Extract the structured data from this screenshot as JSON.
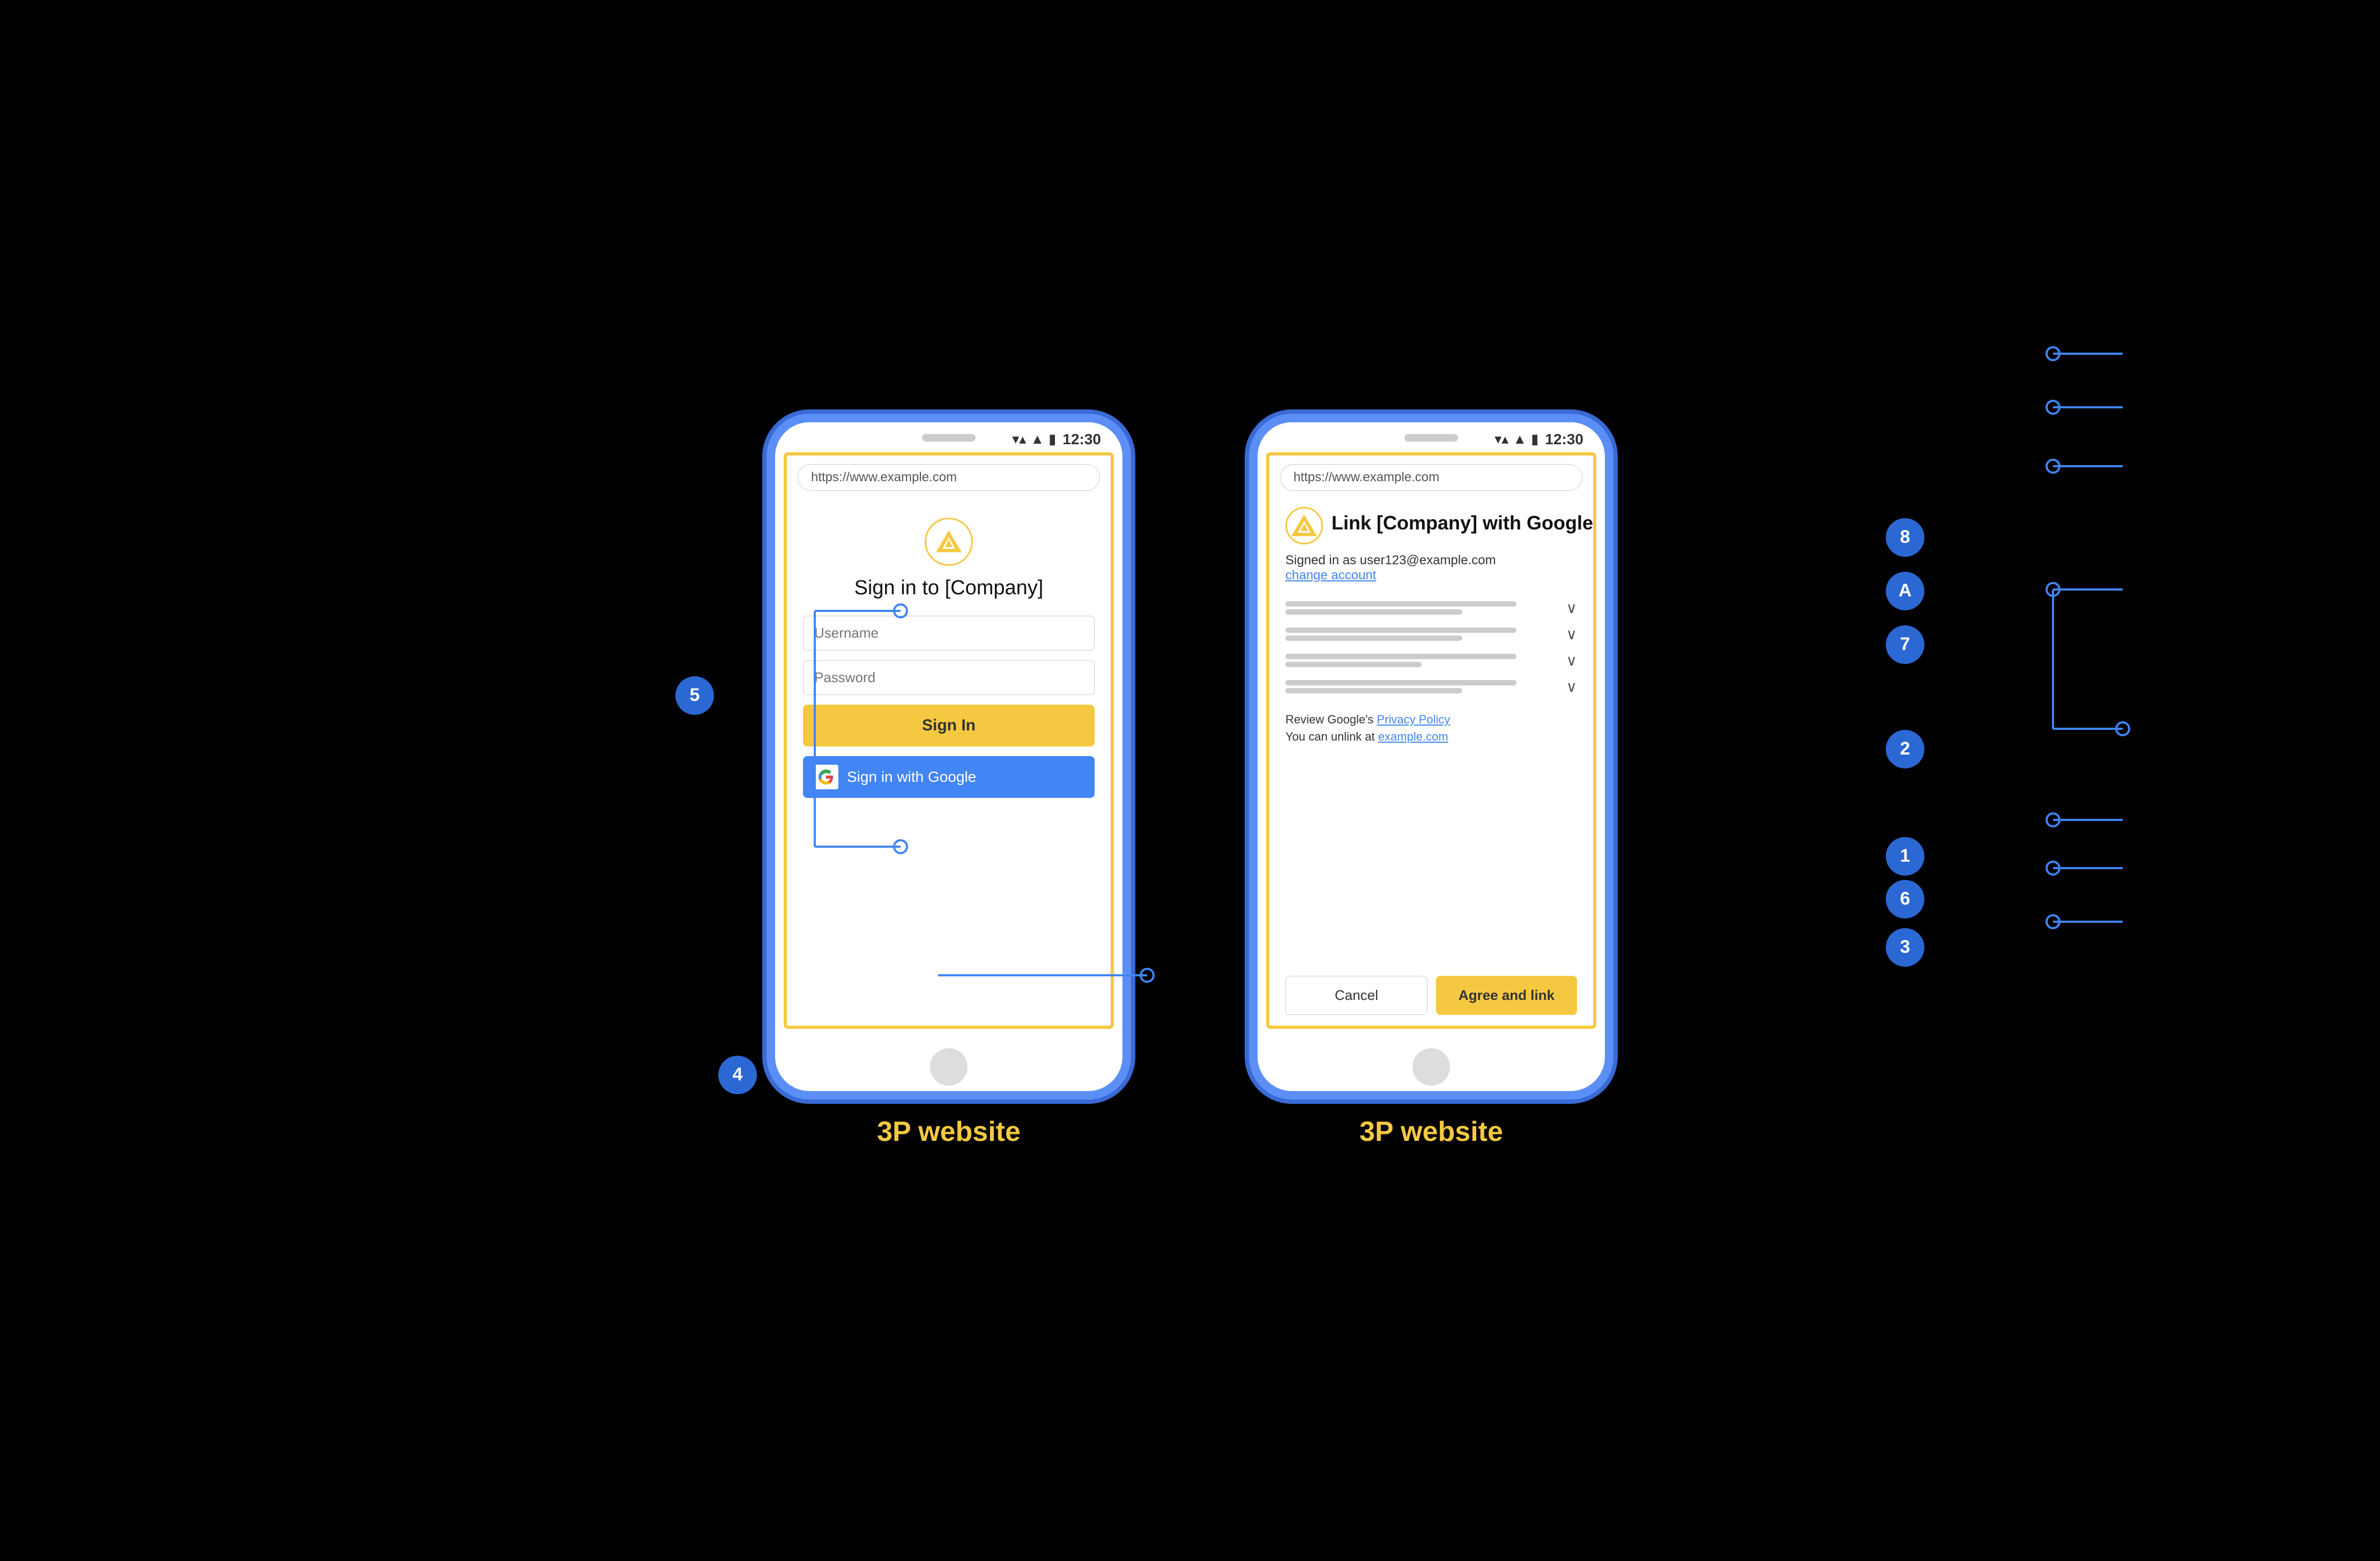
{
  "page": {
    "background": "#000000"
  },
  "phone1": {
    "label": "3P website",
    "status": {
      "time": "12:30",
      "wifi_icon": "▼",
      "signal_icon": "▲",
      "battery_icon": "▮"
    },
    "url": "https://www.example.com",
    "logo_shape": "triangle",
    "title": "Sign in to [Company]",
    "username_placeholder": "Username",
    "password_placeholder": "Password",
    "sign_in_label": "Sign In",
    "google_sign_in_label": "Sign in with Google"
  },
  "phone2": {
    "label": "3P website",
    "status": {
      "time": "12:30"
    },
    "url": "https://www.example.com",
    "logo_shape": "triangle",
    "title": "Link [Company] with Google",
    "signed_in_text": "Signed in as user123@example.com",
    "change_account": "change account",
    "privacy_text1": "Review Google's ",
    "privacy_link": "Privacy Policy",
    "unlink_text1": "You can unlink at ",
    "unlink_link": "example.com",
    "cancel_label": "Cancel",
    "agree_label": "Agree and link"
  },
  "badges": [
    {
      "id": "1",
      "label": "1"
    },
    {
      "id": "2",
      "label": "2"
    },
    {
      "id": "3",
      "label": "3"
    },
    {
      "id": "4",
      "label": "4"
    },
    {
      "id": "5",
      "label": "5"
    },
    {
      "id": "6",
      "label": "6"
    },
    {
      "id": "7",
      "label": "7"
    },
    {
      "id": "8",
      "label": "8"
    },
    {
      "id": "A",
      "label": "A"
    }
  ]
}
